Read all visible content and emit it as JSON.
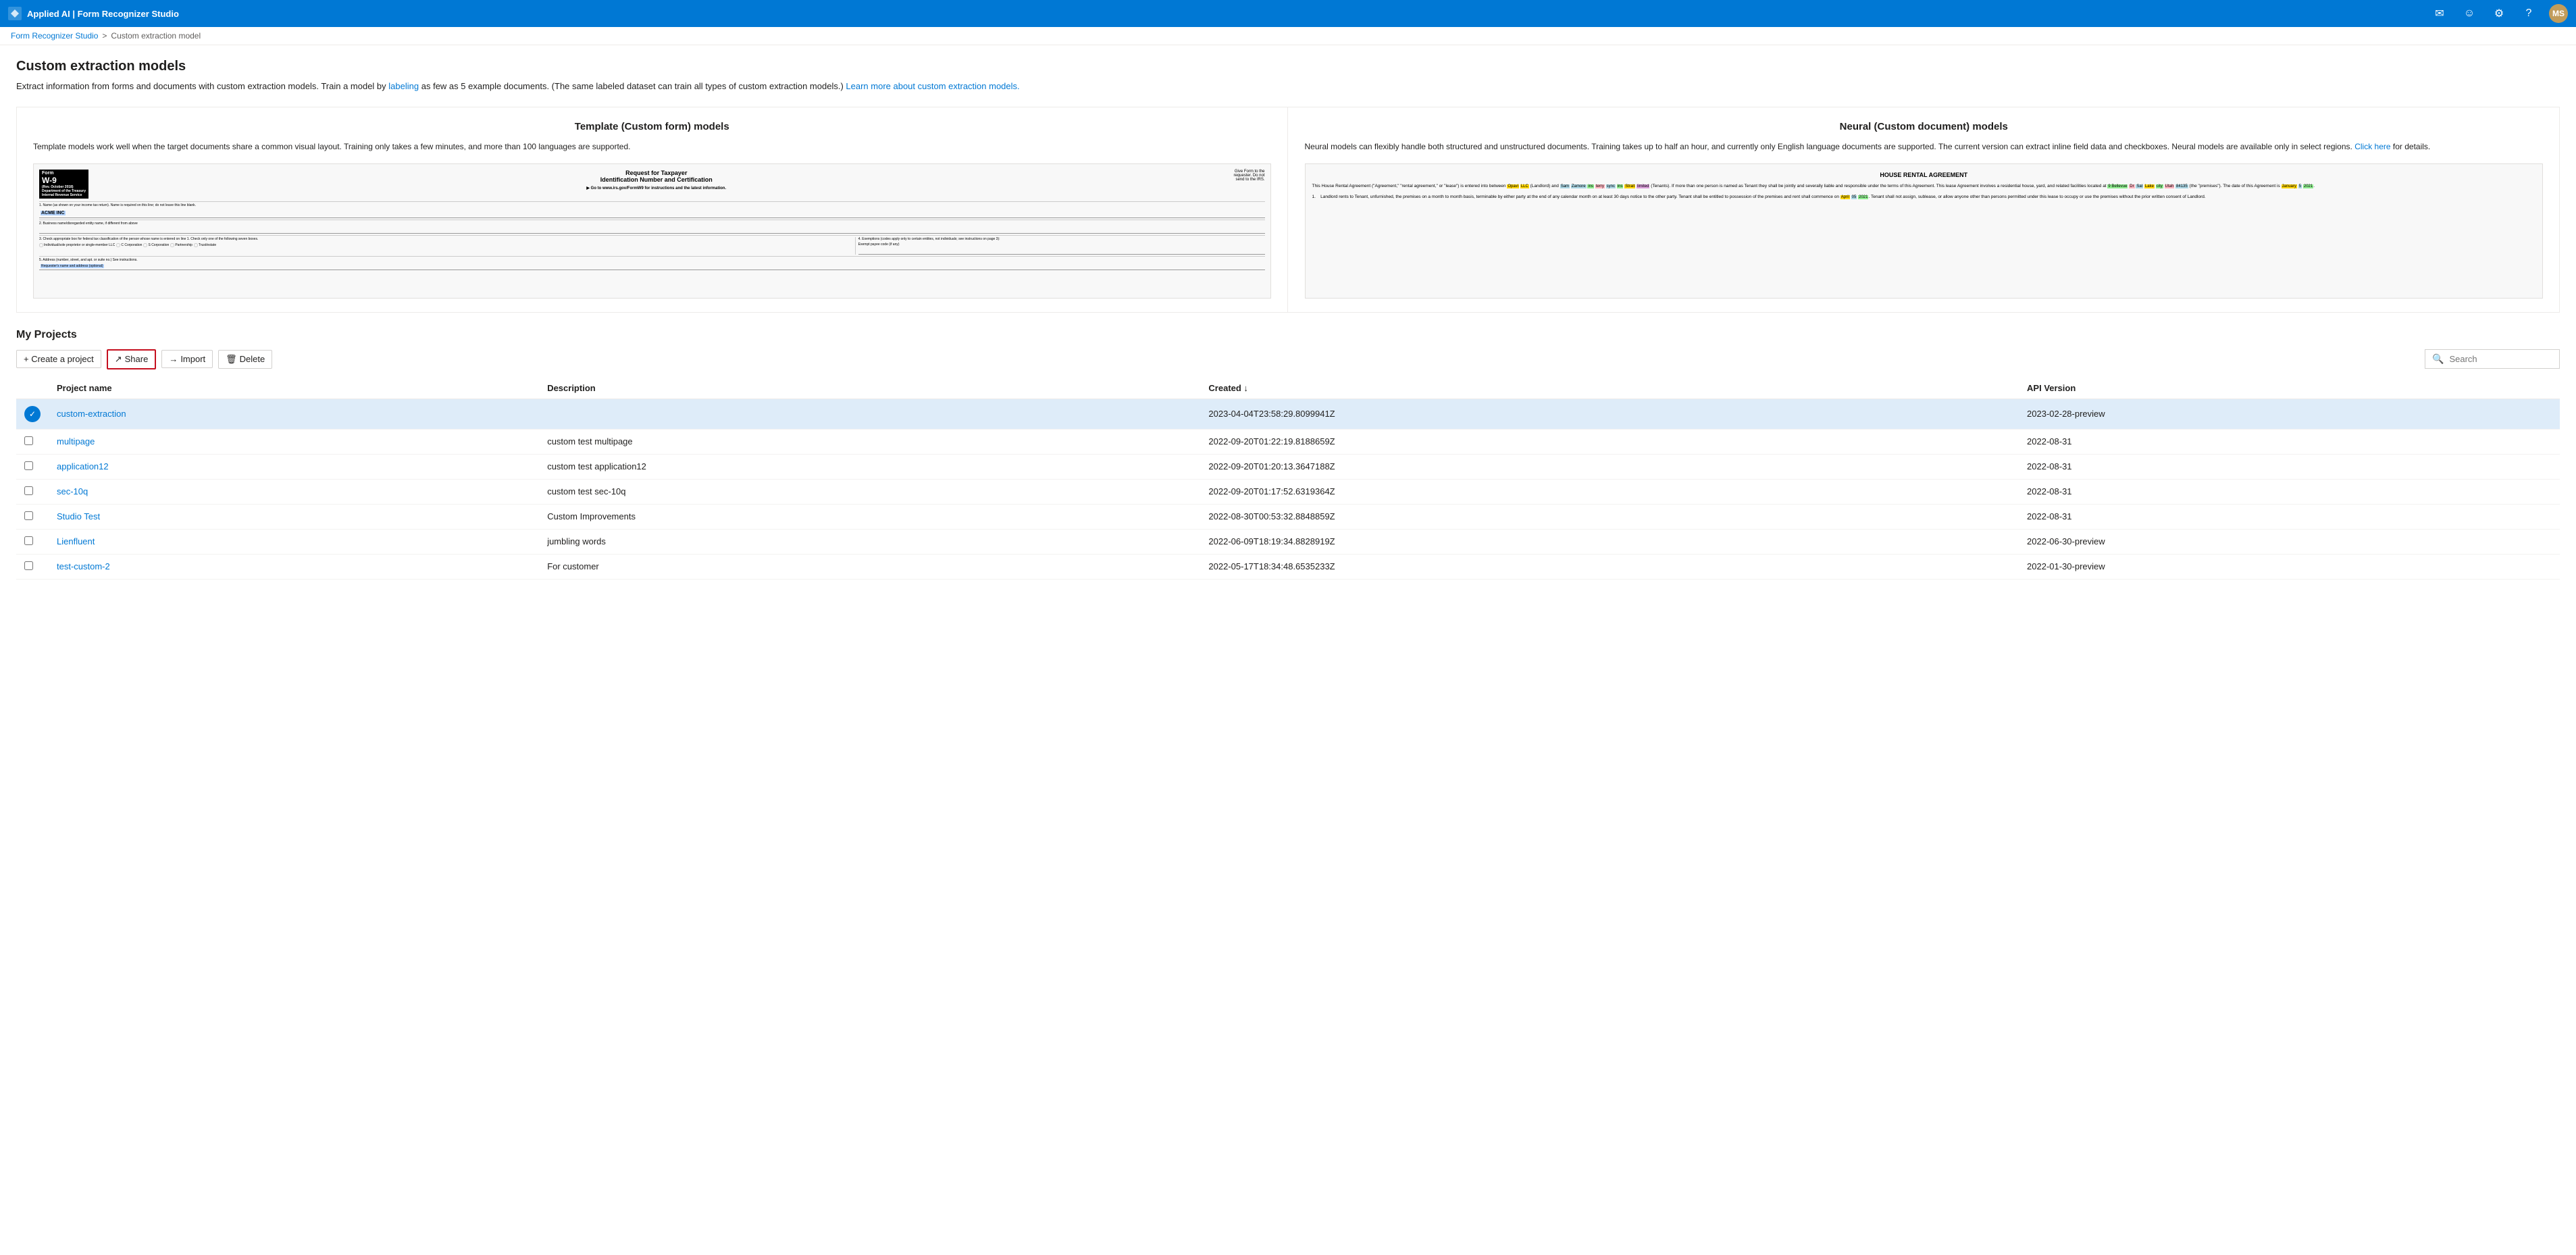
{
  "app": {
    "title": "Applied AI | Form Recognizer Studio",
    "brand": "Applied AI | Form Recognizer Studio"
  },
  "topbar": {
    "icons": [
      "mail-icon",
      "emoji-icon",
      "settings-icon",
      "help-icon"
    ],
    "avatar_label": "MS"
  },
  "breadcrumb": {
    "root": "Form Recognizer Studio",
    "separator": ">",
    "current": "Custom extraction model"
  },
  "page": {
    "title": "Custom extraction models",
    "description_part1": "Extract information from forms and documents with custom extraction models. Train a model by",
    "description_link1": "labeling",
    "description_part2": "as few as 5 example documents. (The same labeled dataset can train all types of custom extraction models.)",
    "description_link2": "Learn more about custom extraction models.",
    "description_link2_url": "#"
  },
  "template_card": {
    "title": "Template (Custom form) models",
    "description": "Template models work well when the target documents share a common visual layout. Training only takes a few minutes, and more than 100 languages are supported."
  },
  "neural_card": {
    "title": "Neural (Custom document) models",
    "description": "Neural models can flexibly handle both structured and unstructured documents. Training takes up to half an hour, and currently only English language documents are supported. The current version can extract inline field data and checkboxes. Neural models are available only in select regions.",
    "link_text": "Click here",
    "link_suffix": "for details."
  },
  "projects": {
    "section_title": "My Projects",
    "toolbar": {
      "create_label": "+ Create a project",
      "share_label": "Share",
      "import_label": "Import",
      "delete_label": "Delete"
    },
    "search_placeholder": "Search",
    "table": {
      "columns": [
        "Project name",
        "Description",
        "Created ↓",
        "API Version"
      ],
      "rows": [
        {
          "name": "custom-extraction",
          "description": "",
          "created": "2023-04-04T23:58:29.8099941Z",
          "api_version": "2023-02-28-preview",
          "selected": true
        },
        {
          "name": "multipage",
          "description": "custom test multipage",
          "created": "2022-09-20T01:22:19.8188659Z",
          "api_version": "2022-08-31",
          "selected": false
        },
        {
          "name": "application12",
          "description": "custom test application12",
          "created": "2022-09-20T01:20:13.3647188Z",
          "api_version": "2022-08-31",
          "selected": false
        },
        {
          "name": "sec-10q",
          "description": "custom test sec-10q",
          "created": "2022-09-20T01:17:52.6319364Z",
          "api_version": "2022-08-31",
          "selected": false
        },
        {
          "name": "Studio Test",
          "description": "Custom Improvements",
          "created": "2022-08-30T00:53:32.8848859Z",
          "api_version": "2022-08-31",
          "selected": false
        },
        {
          "name": "Lienfluent",
          "description": "jumbling words",
          "created": "2022-06-09T18:19:34.8828919Z",
          "api_version": "2022-06-30-preview",
          "selected": false
        },
        {
          "name": "test-custom-2",
          "description": "For customer",
          "created": "2022-05-17T18:34:48.6535233Z",
          "api_version": "2022-01-30-preview",
          "selected": false
        }
      ]
    }
  }
}
